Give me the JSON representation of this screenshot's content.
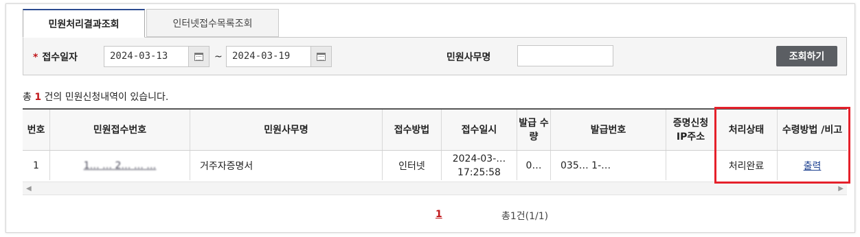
{
  "tabs": [
    {
      "label": "민원처리결과조회",
      "active": true
    },
    {
      "label": "인터넷접수목록조회",
      "active": false
    }
  ],
  "search": {
    "date_label": "접수일자",
    "required_mark": "*",
    "date_from": "2024-03-13",
    "date_to": "2024-03-19",
    "separator": "~",
    "name_label": "민원사무명",
    "name_value": "",
    "button_label": "조회하기"
  },
  "summary": {
    "prefix": "총",
    "count": "1",
    "suffix": "건의 민원신청내역이 있습니다."
  },
  "table": {
    "headers": [
      "번호",
      "민원접수번호",
      "민원사무명",
      "접수방법",
      "접수일시",
      "발급\n수량",
      "발급번호",
      "증명신청\nIP주소",
      "처리상태",
      "수령방법\n/비고"
    ],
    "rows": [
      {
        "no": "1",
        "receipt_no": "1… … 2… … …",
        "service_name": "거주자증명서",
        "method": "인터넷",
        "datetime_line1": "2024-03-…",
        "datetime_line2": "17:25:58",
        "quantity": "0…",
        "issue_no": "035… 1-…",
        "ip": "",
        "status": "처리완료",
        "action": "출력"
      }
    ]
  },
  "pager": {
    "current": "1",
    "total_text": "총1건(1/1)"
  },
  "colors": {
    "accent_red": "#c0171b",
    "highlight_border": "#e5202a",
    "button_bg": "#5b5e63",
    "tab_top": "#2b4a8f"
  }
}
